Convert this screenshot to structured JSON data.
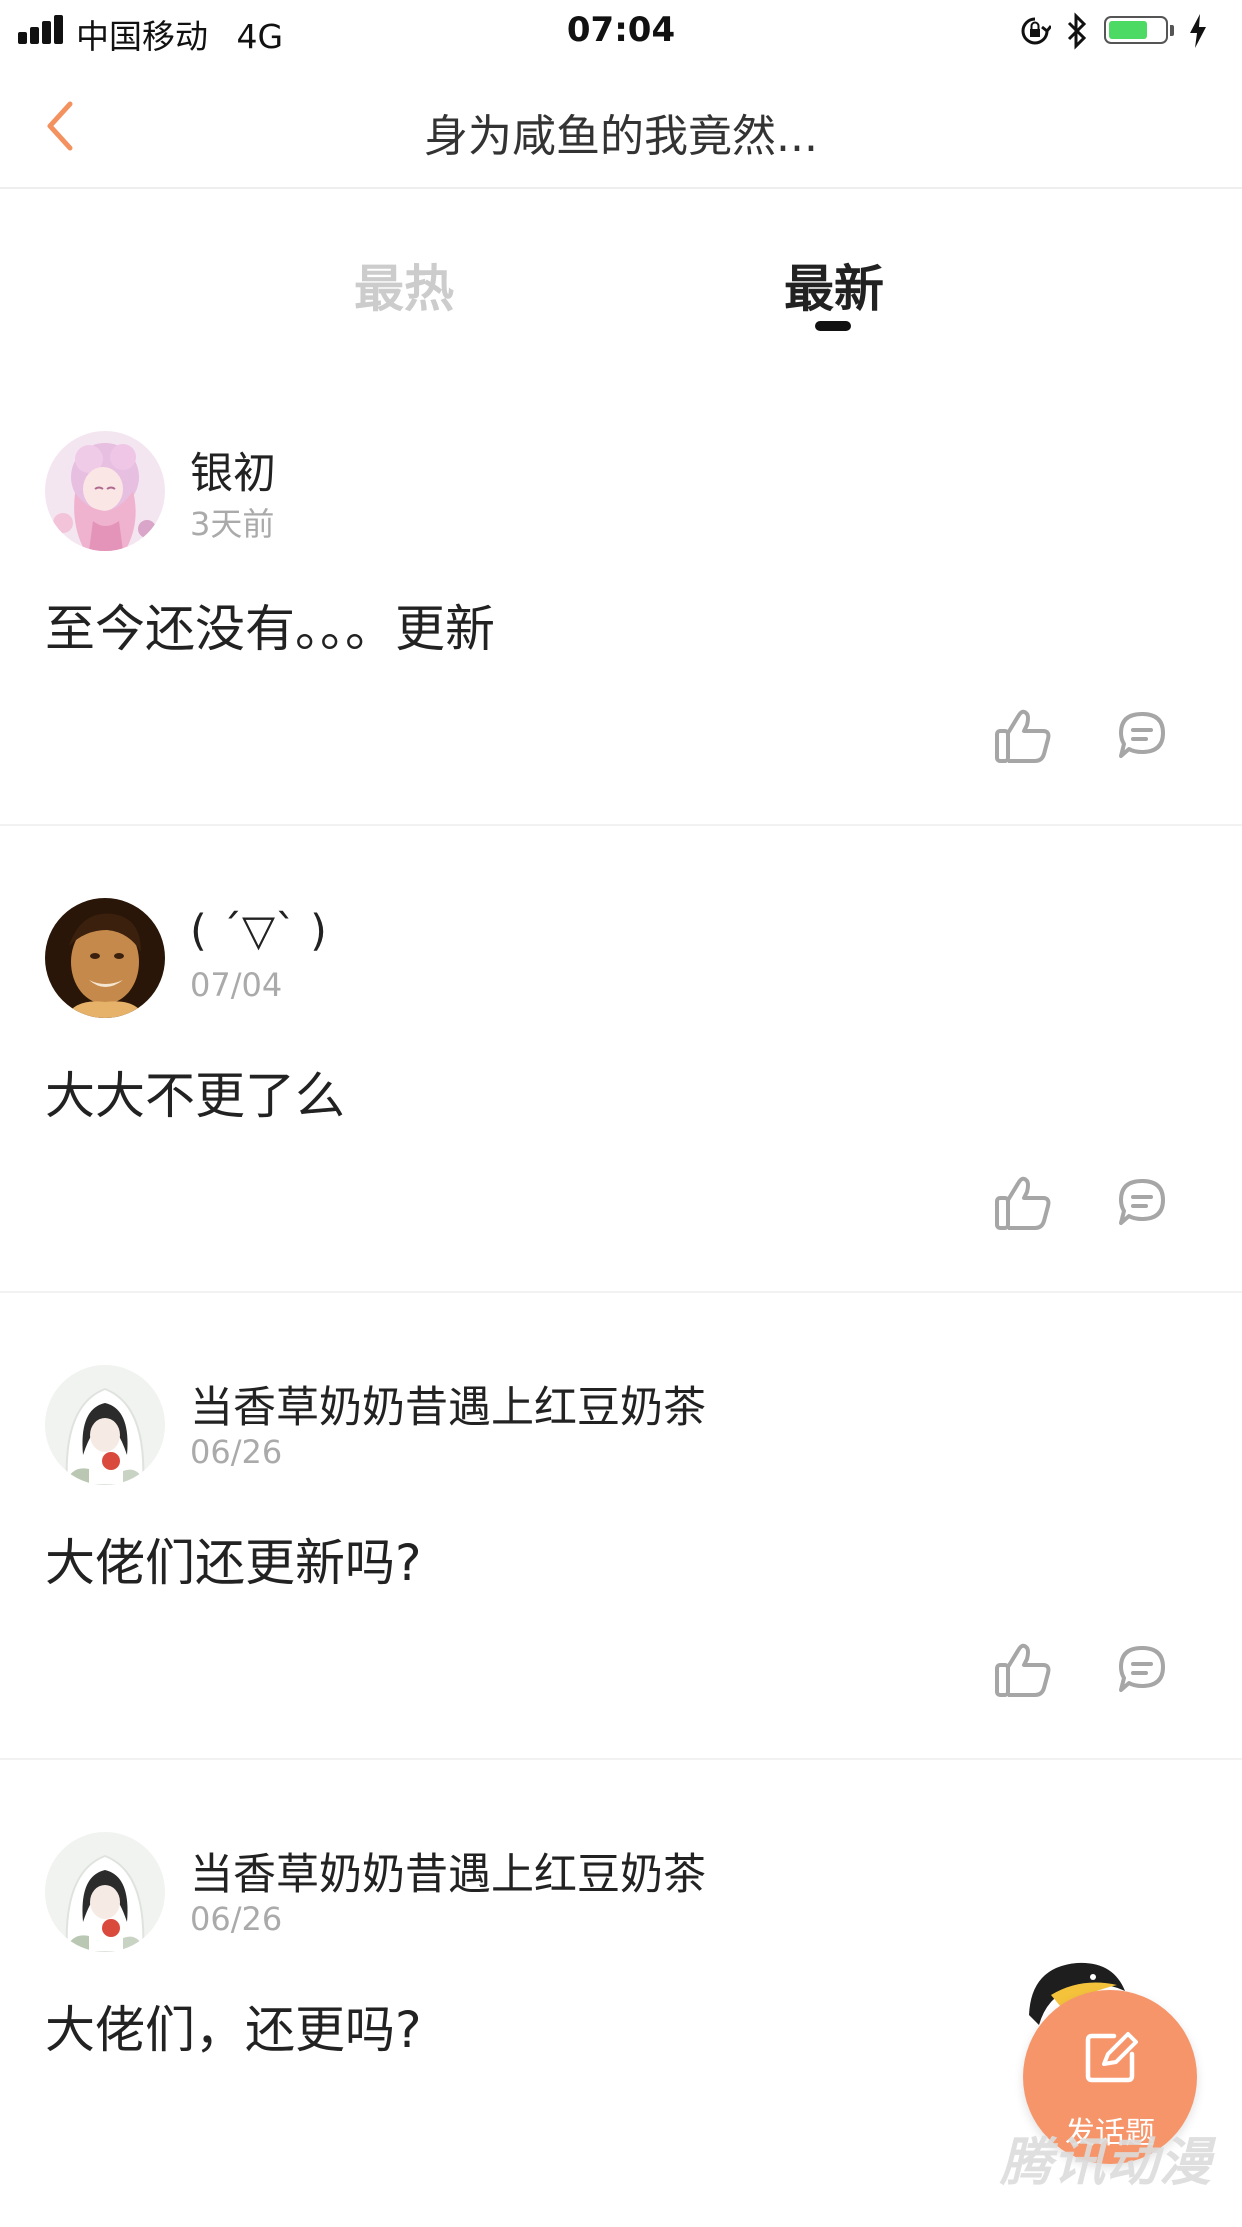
{
  "status_bar": {
    "carrier": "中国移动",
    "network": "4G",
    "time": "07:04",
    "battery_level": 0.7,
    "battery_color": "#4cd964"
  },
  "nav": {
    "title": "身为咸鱼的我竟然...",
    "back_icon": "chevron-left-icon",
    "accent_color": "#f3915f"
  },
  "tabs": [
    {
      "label": "最热",
      "active": false
    },
    {
      "label": "最新",
      "active": true
    }
  ],
  "comments": [
    {
      "username": "银初",
      "time": "3天前",
      "content": "至今还没有。。。更新",
      "avatar": "anime-girl-avatar"
    },
    {
      "username": "( ´▽` )",
      "time": "07/04",
      "content": "大大不更了么",
      "avatar": "smiling-man-avatar"
    },
    {
      "username": "当香草奶奶昔遇上红豆奶茶",
      "time": "06/26",
      "content": "大佬们还更新吗?",
      "avatar": "white-hood-girl-avatar"
    },
    {
      "username": "当香草奶奶昔遇上红豆奶茶",
      "time": "06/26",
      "content": "大佬们，还更吗?",
      "avatar": "white-hood-girl-avatar"
    }
  ],
  "actions": {
    "like_icon": "thumbs-up-icon",
    "reply_icon": "comment-bubble-icon"
  },
  "fab": {
    "label": "发话题",
    "icon": "edit-icon",
    "color": "#f6956a"
  },
  "watermark": "腾讯动漫"
}
